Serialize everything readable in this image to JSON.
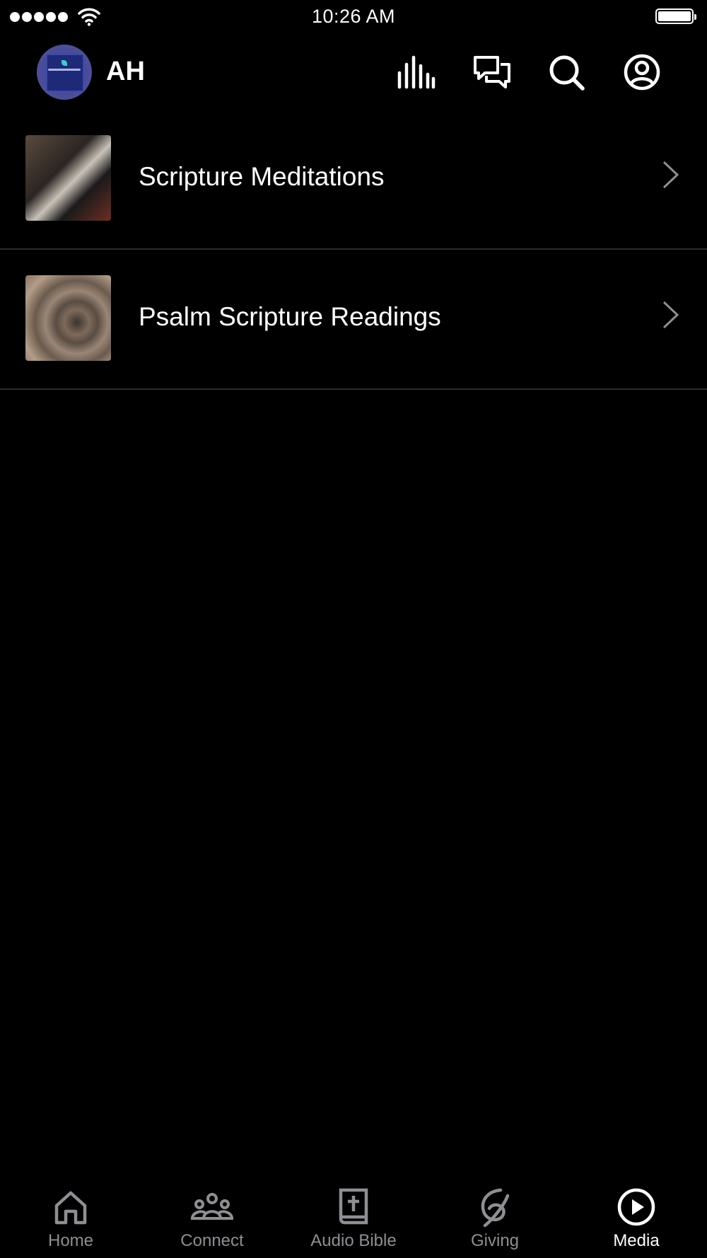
{
  "status_bar": {
    "time": "10:26 AM"
  },
  "header": {
    "org_initials": "AH"
  },
  "list": [
    {
      "title": "Scripture Meditations"
    },
    {
      "title": "Psalm Scripture Readings"
    }
  ],
  "tabs": [
    {
      "label": "Home",
      "icon": "home-icon",
      "active": false
    },
    {
      "label": "Connect",
      "icon": "people-icon",
      "active": false
    },
    {
      "label": "Audio Bible",
      "icon": "bible-icon",
      "active": false
    },
    {
      "label": "Giving",
      "icon": "giving-icon",
      "active": false
    },
    {
      "label": "Media",
      "icon": "play-circle-icon",
      "active": true
    }
  ],
  "colors": {
    "background": "#000000",
    "inactive_tab": "#8e8e93",
    "active_tab": "#ffffff",
    "separator": "#2c2c2e"
  }
}
